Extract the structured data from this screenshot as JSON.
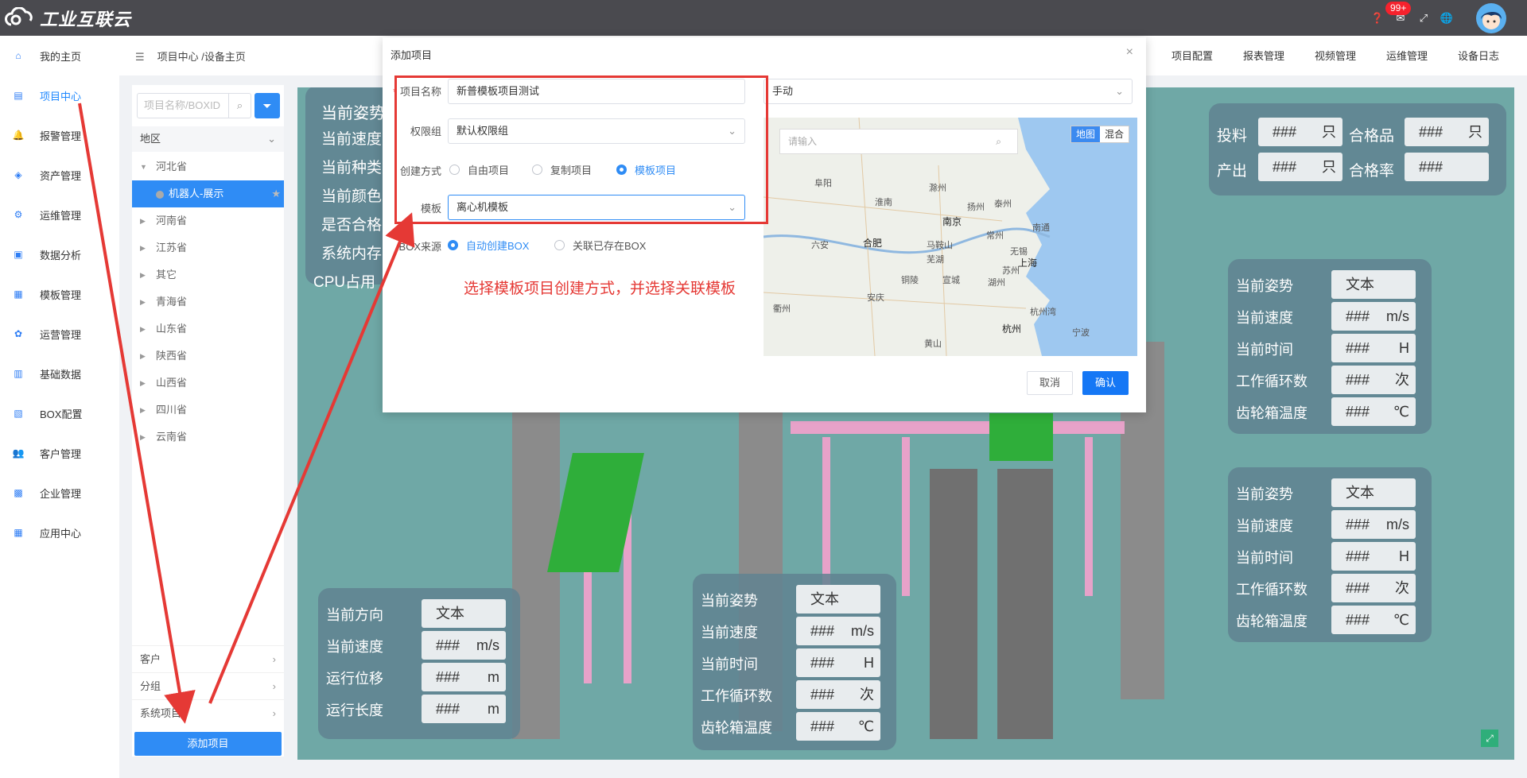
{
  "app": {
    "logo_text": "工业互联云",
    "badge": "99+"
  },
  "topbar": {
    "icons": [
      "help-icon",
      "mail-icon",
      "fullscreen-icon",
      "globe-icon"
    ]
  },
  "sidebar": {
    "items": [
      {
        "label": "我的主页",
        "icon": "home-icon"
      },
      {
        "label": "项目中心",
        "icon": "project-icon",
        "active": true
      },
      {
        "label": "报警管理",
        "icon": "bell-icon"
      },
      {
        "label": "资产管理",
        "icon": "asset-icon"
      },
      {
        "label": "运维管理",
        "icon": "gear-icon"
      },
      {
        "label": "数据分析",
        "icon": "monitor-icon"
      },
      {
        "label": "模板管理",
        "icon": "template-icon"
      },
      {
        "label": "运营管理",
        "icon": "operation-icon"
      },
      {
        "label": "基础数据",
        "icon": "database-icon"
      },
      {
        "label": "BOX配置",
        "icon": "box-icon"
      },
      {
        "label": "客户管理",
        "icon": "users-icon"
      },
      {
        "label": "企业管理",
        "icon": "briefcase-icon"
      },
      {
        "label": "应用中心",
        "icon": "apps-icon"
      }
    ]
  },
  "breadcrumb": {
    "text": "项目中心 /设备主页"
  },
  "topnav": [
    "项目配置",
    "报表管理",
    "视频管理",
    "运维管理",
    "设备日志"
  ],
  "leftpanel": {
    "search_placeholder": "项目名称/BOXID",
    "region_label": "地区",
    "tree": [
      {
        "label": "河北省",
        "expanded": true
      },
      {
        "label": "机器人-展示",
        "selected": true
      },
      {
        "label": "河南省"
      },
      {
        "label": "江苏省"
      },
      {
        "label": "其它"
      },
      {
        "label": "青海省"
      },
      {
        "label": "山东省"
      },
      {
        "label": "陕西省"
      },
      {
        "label": "山西省"
      },
      {
        "label": "四川省"
      },
      {
        "label": "云南省"
      }
    ],
    "bottom": [
      "客户",
      "分组",
      "系统项目"
    ],
    "add_button": "添加项目"
  },
  "scene": {
    "left_card": [
      "当前姿势",
      "当前速度",
      "当前种类",
      "当前颜色",
      "是否合格",
      "系统内存",
      "CPU占用"
    ],
    "top_right": {
      "labels": [
        "投料",
        "合格品",
        "产出",
        "合格率"
      ],
      "values": [
        "###",
        "###",
        "###",
        "###"
      ],
      "units": [
        "只",
        "只",
        "只",
        ""
      ]
    },
    "right_card1": {
      "labels": [
        "当前姿势",
        "当前速度",
        "当前时间",
        "工作循环数",
        "齿轮箱温度"
      ],
      "values": [
        "文本",
        "###",
        "###",
        "###",
        "###"
      ],
      "units": [
        "",
        "m/s",
        "H",
        "次",
        "℃"
      ]
    },
    "right_card2": {
      "labels": [
        "当前姿势",
        "当前速度",
        "当前时间",
        "工作循环数",
        "齿轮箱温度"
      ],
      "values": [
        "文本",
        "###",
        "###",
        "###",
        "###"
      ],
      "units": [
        "",
        "m/s",
        "H",
        "次",
        "℃"
      ]
    },
    "bottom_left": {
      "labels": [
        "当前方向",
        "当前速度",
        "运行位移",
        "运行长度"
      ],
      "values": [
        "文本",
        "###",
        "###",
        "###"
      ],
      "units": [
        "",
        "m/s",
        "m",
        "m"
      ]
    },
    "bottom_center": {
      "labels": [
        "当前姿势",
        "当前速度",
        "当前时间",
        "工作循环数",
        "齿轮箱温度"
      ],
      "values": [
        "文本",
        "###",
        "###",
        "###",
        "###"
      ],
      "units": [
        "",
        "m/s",
        "H",
        "次",
        "℃"
      ]
    }
  },
  "dialog": {
    "title": "添加项目",
    "fields": {
      "name_label": "项目名称",
      "name_value": "新普模板项目测试",
      "perm_label": "权限组",
      "perm_value": "默认权限组",
      "create_label": "创建方式",
      "create_options": [
        "自由项目",
        "复制项目",
        "模板项目"
      ],
      "template_label": "模板",
      "template_value": "离心机模板",
      "box_label": "BOX来源",
      "box_options": [
        "自动创建BOX",
        "关联已存在BOX"
      ],
      "mode_value": "手动"
    },
    "map": {
      "search_placeholder": "请输入",
      "type_options": [
        "地图",
        "混合"
      ],
      "cities": [
        "南京",
        "合肥",
        "上海",
        "杭州",
        "阜阳",
        "马鞍山",
        "芜湖",
        "铜陵",
        "安庆",
        "黄山",
        "宣城",
        "湖州",
        "常州",
        "无锡",
        "苏州",
        "南通",
        "泰州",
        "扬州",
        "杭州湾",
        "宁波",
        "六安",
        "衢州",
        "滁州",
        "淮南"
      ]
    },
    "cancel": "取消",
    "ok": "确认"
  },
  "annotation": {
    "text": "选择模板项目创建方式，并选择关联模板"
  }
}
